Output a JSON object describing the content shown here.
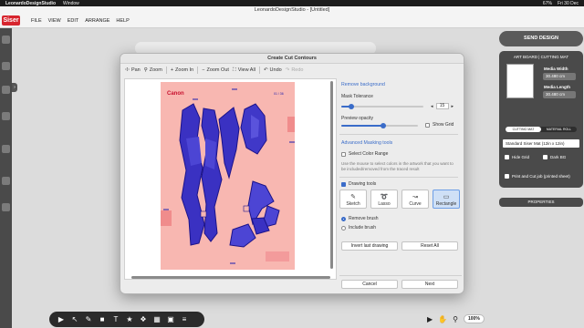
{
  "menubar": {
    "app": "LeonardoDesignStudio",
    "window": "Window",
    "status": "67%",
    "clock": "Fri 30 Dec"
  },
  "app": {
    "title": "LeonardoDesignStudio - [Untitled]",
    "logo": "Siser",
    "menu": [
      "FILE",
      "VIEW",
      "EDIT",
      "ARRANGE",
      "HELP"
    ]
  },
  "right_panel": {
    "send_design": "SEND DESIGN",
    "tabs": "ART BOARD  |  CUTTING MAT",
    "media_width_label": "Media Width",
    "media_width": "30.480 cm",
    "media_length_label": "Media Length",
    "media_length": "30.480 cm",
    "mode_cutting_mat": "CUTTING MAT",
    "mode_material_roll": "MATERIAL ROLL",
    "mat_select": "Standard Siser Mat (12in x 12in)",
    "hide_grid": "Hide Grid",
    "dark_bg": "Dark BG",
    "print_and_cut": "Print and Cut job (printed sheet)",
    "properties": "PROPERTIES"
  },
  "bottom": {
    "zoom": "100%"
  },
  "dialog": {
    "title": "Create Cut Contours",
    "toolbar": {
      "pan": "Pan",
      "zoom": "Zoom",
      "zoom_in": "Zoom In",
      "zoom_out": "Zoom Out",
      "view_all": "View All",
      "undo": "Undo",
      "redo": "Redo"
    },
    "artwork": {
      "brand": "Canon",
      "page_label": "01 / 36"
    },
    "side": {
      "remove_background": "Remove background",
      "mask_tolerance": "Mask Tolerance",
      "mask_tolerance_value": "15",
      "mask_tolerance_fraction": 0.12,
      "preview_opacity": "Preview opacity",
      "preview_opacity_fraction": 0.55,
      "show_grid": "Show Grid",
      "advanced_masking": "Advanced Masking tools",
      "select_color_range": "Select Color Range",
      "hint": "Use the mouse to select colors in the artwork that you want to be included/removed from the traced result",
      "drawing_tools": "Drawing tools",
      "tools": [
        {
          "icon": "✎",
          "label": "Sketch"
        },
        {
          "icon": "➰",
          "label": "Lasso"
        },
        {
          "icon": "↝",
          "label": "Curve"
        },
        {
          "icon": "▭",
          "label": "Rectangle"
        }
      ],
      "remove_brush": "Remove brush",
      "include_brush": "Include brush",
      "invert_last": "Invert last drawing",
      "reset_all": "Reset All"
    },
    "cancel": "Cancel",
    "next": "Next"
  }
}
